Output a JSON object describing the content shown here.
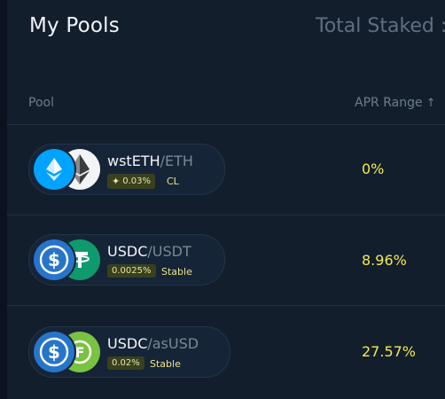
{
  "header": {
    "title": "My Pools",
    "total_staked_label": "Total Staked :"
  },
  "table": {
    "columns": {
      "pool": "Pool",
      "apr": "APR Range",
      "apr_sort_icon": "arrow-up-icon"
    },
    "rows": [
      {
        "base": "wstETH",
        "separator_quote": "/ETH",
        "fee": "0.03%",
        "fee_icon": "sparkle-icon",
        "type": "CL",
        "apr": "0%",
        "token_icons": [
          "wsteth-icon",
          "eth-icon"
        ]
      },
      {
        "base": "USDC",
        "separator_quote": "/USDT",
        "fee": "0.0025%",
        "type": "Stable",
        "apr": "8.96%",
        "token_icons": [
          "usdc-icon",
          "usdt-icon"
        ]
      },
      {
        "base": "USDC",
        "separator_quote": "/asUSD",
        "fee": "0.02%",
        "type": "Stable",
        "apr": "27.57%",
        "token_icons": [
          "usdc-icon",
          "asusd-icon"
        ]
      }
    ]
  },
  "colors": {
    "apr": "#f1ea4f",
    "usdc": "#2775ca",
    "usdt": "#0f9a6e",
    "asusd": "#7ac342",
    "wsteth": "#00a3ff"
  }
}
